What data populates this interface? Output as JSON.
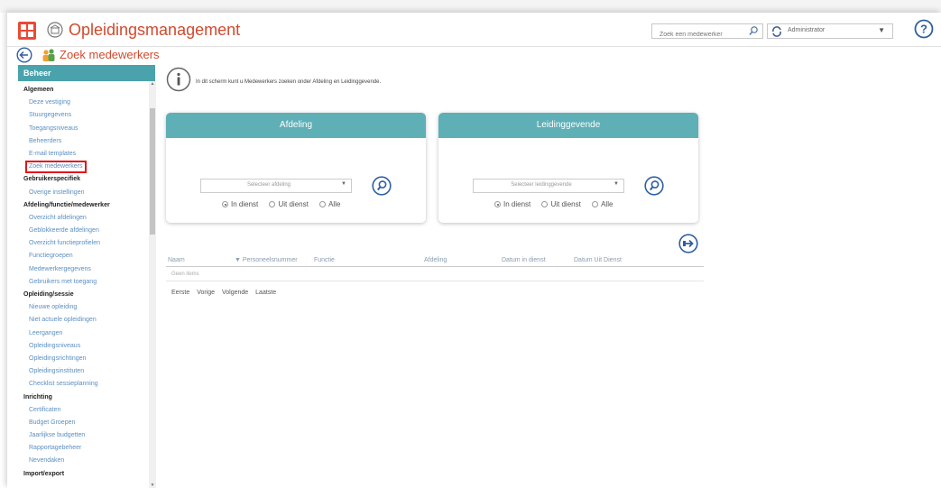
{
  "app": {
    "title": "Opleidingsmanagement",
    "accent": "#d04a2e",
    "logo_color": "#e94a35"
  },
  "header": {
    "search_placeholder": "Zoek een medewerker",
    "user": "Administrator",
    "help_icon": "question-circle-icon"
  },
  "page": {
    "title": "Zoek medewerkers",
    "info": "In dit scherm kunt u Medewerkers zoeken onder Afdeling en Leidinggevende."
  },
  "sidebar": {
    "header": "Beheer",
    "header_color": "#4aa3ac",
    "items": [
      {
        "type": "cat",
        "label": "Algemeen"
      },
      {
        "type": "item",
        "label": "Deze vestiging"
      },
      {
        "type": "item",
        "label": "Stuurgegevens"
      },
      {
        "type": "item",
        "label": "Toegangsniveaus"
      },
      {
        "type": "item",
        "label": "Beheerders"
      },
      {
        "type": "item",
        "label": "E-mail templates"
      },
      {
        "type": "item",
        "label": "Zoek medewerkers",
        "selected": true
      },
      {
        "type": "cat",
        "label": "Gebruikerspecifiek"
      },
      {
        "type": "item",
        "label": "Overige instellingen"
      },
      {
        "type": "cat",
        "label": "Afdeling/functie/medewerker"
      },
      {
        "type": "item",
        "label": "Overzicht afdelingen"
      },
      {
        "type": "item",
        "label": "Geblokkeerde afdelingen"
      },
      {
        "type": "item",
        "label": "Overzicht functieprofielen"
      },
      {
        "type": "item",
        "label": "Functiegroepen"
      },
      {
        "type": "item",
        "label": "Medewerkergegevens"
      },
      {
        "type": "item",
        "label": "Gebruikers met toegang"
      },
      {
        "type": "cat",
        "label": "Opleiding/sessie"
      },
      {
        "type": "item",
        "label": "Nieuwe opleiding"
      },
      {
        "type": "item",
        "label": "Niet actuele opleidingen"
      },
      {
        "type": "item",
        "label": "Leergangen"
      },
      {
        "type": "item",
        "label": "Opleidingsniveaus"
      },
      {
        "type": "item",
        "label": "Opleidingsrichtingen"
      },
      {
        "type": "item",
        "label": "Opleidingsinstituten"
      },
      {
        "type": "item",
        "label": "Checklist sessieplanning"
      },
      {
        "type": "cat",
        "label": "Inrichting"
      },
      {
        "type": "item",
        "label": "Certificaten"
      },
      {
        "type": "item",
        "label": "Budget Groepen"
      },
      {
        "type": "item",
        "label": "Jaarlijkse budgetten"
      },
      {
        "type": "item",
        "label": "Rapportagebeheer"
      },
      {
        "type": "item",
        "label": "Nevendaken"
      },
      {
        "type": "cat",
        "label": "Import/export"
      }
    ]
  },
  "panels": {
    "afdeling": {
      "title": "Afdeling",
      "placeholder": "Selecteer afdeling",
      "radios": [
        "In dienst",
        "Uit dienst",
        "Alle"
      ]
    },
    "leidinggevende": {
      "title": "Leidinggevende",
      "placeholder": "Selecteer leidinggevende",
      "radios": [
        "In dienst",
        "Uit dienst",
        "Alle"
      ]
    },
    "header_color": "#5eafb6"
  },
  "grid": {
    "columns": [
      "Naam",
      "▼ Personeelsnummer",
      "Functie",
      "Afdeling",
      "Datum in dienst",
      "Datum Uit Dienst"
    ],
    "empty": "Geen items"
  },
  "pager": [
    "Eerste",
    "Vorige",
    "Volgende",
    "Laatste"
  ]
}
